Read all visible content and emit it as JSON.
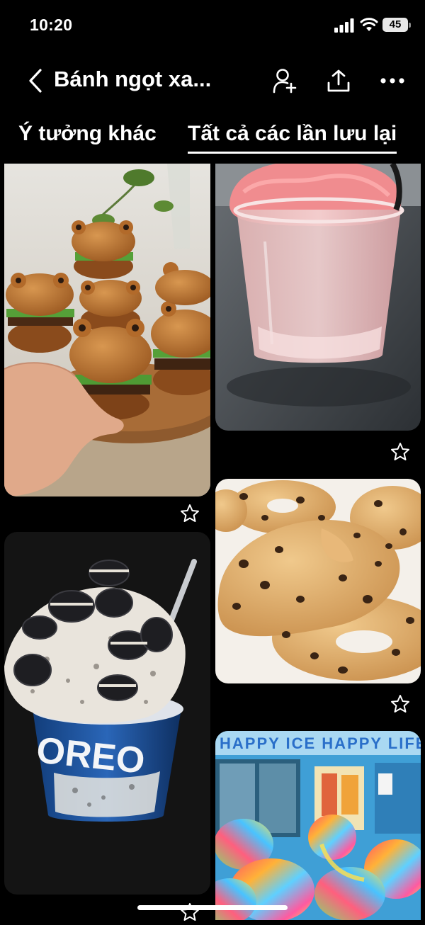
{
  "status_bar": {
    "time": "10:20",
    "battery": "45",
    "icons": [
      "signal-icon",
      "wifi-icon",
      "battery-icon"
    ]
  },
  "header": {
    "title": "Bánh ngọt xa...",
    "icons": [
      "back-chevron-icon",
      "add-person-icon",
      "share-icon",
      "more-icon"
    ]
  },
  "tabs": [
    {
      "label": "Ý tưởng khác",
      "active": false
    },
    {
      "label": "Tất cả các lần lưu lại",
      "active": true
    }
  ],
  "pins": [
    {
      "subject": "frog-shaped burgers"
    },
    {
      "subject": "pink slush cup"
    },
    {
      "subject": "chocolate chip cookie donuts"
    },
    {
      "subject": "oreo ice cream cup",
      "packaging_text": "OREO"
    },
    {
      "subject": "rainbow ice cream shop",
      "sign_text": "HAPPY ICE HAPPY LIFE"
    }
  ],
  "colors": {
    "background": "#000000",
    "text": "#ffffff"
  }
}
